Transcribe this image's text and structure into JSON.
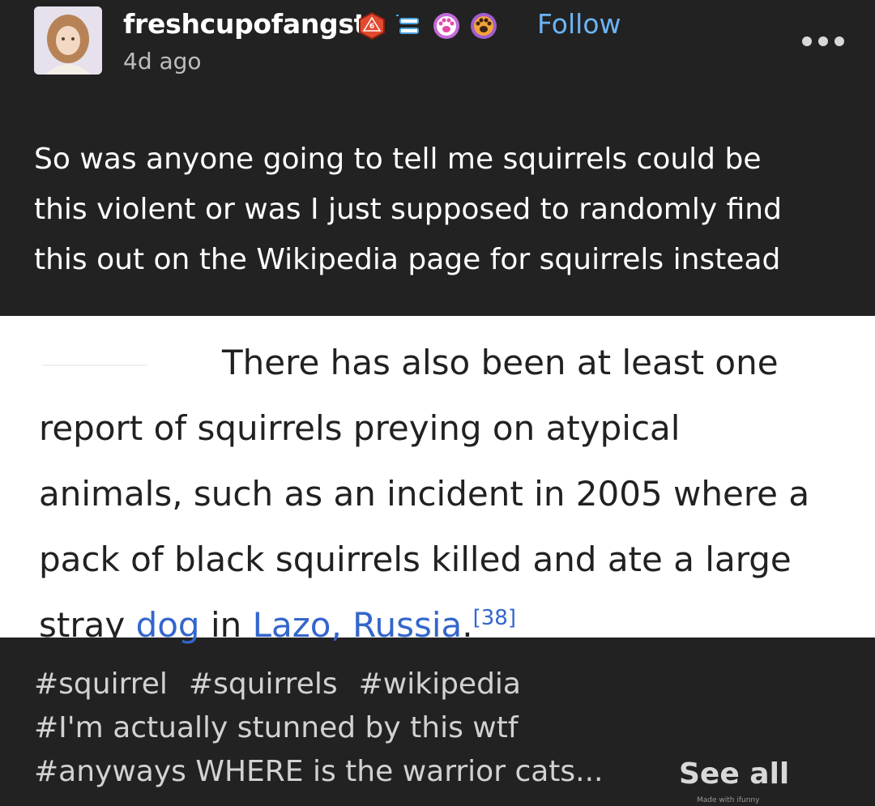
{
  "post": {
    "username": "freshcupofangst",
    "follow_label": "Follow",
    "timestamp": "4d ago",
    "badges": [
      {
        "icon": "d20-dice-icon",
        "text": "6",
        "color": "#e24a2f"
      },
      {
        "icon": "dentures-icon",
        "color": "#4aa3df"
      },
      {
        "icon": "paw-pink-icon",
        "color": "#c46ad9"
      },
      {
        "icon": "paw-orange-icon",
        "color": "#e08a2a"
      }
    ],
    "body_lines": [
      "So was anyone going to tell me squirrels could be",
      "this violent or was I just supposed to randomly find",
      "this out on the Wikipedia page for squirrels instead"
    ]
  },
  "quote": {
    "line1": "There has also been at least one",
    "line2": "report of squirrels preying on atypical",
    "line3": "animals, such as an incident in 2005 where a",
    "line4": "pack of black squirrels killed and ate a large",
    "line5_a": "stray ",
    "link1": "dog",
    "line5_b": " in ",
    "link2": "Lazo, Russia",
    "line5_c": ".",
    "ref": "[38]",
    "link_color": "#3366cc"
  },
  "tags": {
    "row1": [
      "#squirrel",
      "#squirrels",
      "#wikipedia"
    ],
    "row2": "#I'm actually stunned by this wtf",
    "row3": "#anyways WHERE is the warrior cats...",
    "see_all": "See all"
  },
  "watermark": "Made with ifunny"
}
